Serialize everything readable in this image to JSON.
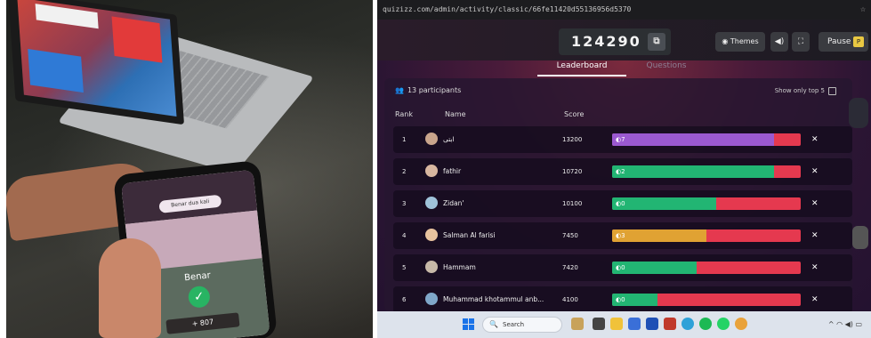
{
  "photo": {
    "phone": {
      "pill_text": "Benar dua kali",
      "result_text": "Benar",
      "score_text": "+ 807"
    }
  },
  "browser": {
    "url": "quizizz.com/admin/activity/classic/66fe11420d55136956d5370"
  },
  "quiz": {
    "game_code": "124290",
    "themes_label": "Themes",
    "pause_label": "Pause",
    "pause_key": "P",
    "tabs": [
      "Leaderboard",
      "Questions"
    ],
    "participants_text": "13 participants",
    "show_top_label": "Show only top 5",
    "headers": {
      "rank": "Rank",
      "name": "Name",
      "score": "Score"
    },
    "colors": {
      "correct": "#22b573",
      "incorrect": "#e5394f",
      "purple": "#9b59d0",
      "orange": "#e0a233"
    },
    "rows": [
      {
        "rank": "1",
        "name": "ابتى",
        "score": "13200",
        "streak": "7",
        "correct_fraction": 0.86,
        "fill_color": "#9b59d0"
      },
      {
        "rank": "2",
        "name": "fathir",
        "score": "10720",
        "streak": "2",
        "correct_fraction": 0.86,
        "fill_color": "#22b573"
      },
      {
        "rank": "3",
        "name": "Zidan'",
        "score": "10100",
        "streak": "0",
        "correct_fraction": 0.55,
        "fill_color": "#22b573"
      },
      {
        "rank": "4",
        "name": "Salman Al farisi",
        "score": "7450",
        "streak": "3",
        "correct_fraction": 0.5,
        "fill_color": "#e0a233"
      },
      {
        "rank": "5",
        "name": "Hammam",
        "score": "7420",
        "streak": "0",
        "correct_fraction": 0.45,
        "fill_color": "#22b573"
      },
      {
        "rank": "6",
        "name": "Muhammad khotammul anb...",
        "score": "4100",
        "streak": "0",
        "correct_fraction": 0.24,
        "fill_color": "#22b573"
      }
    ]
  },
  "taskbar": {
    "search_placeholder": "Search"
  }
}
